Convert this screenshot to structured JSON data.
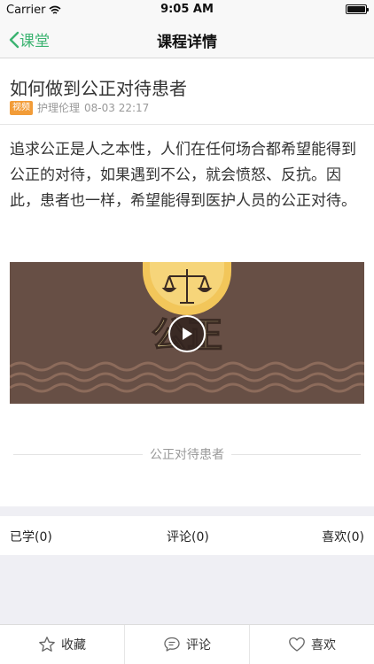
{
  "status_bar": {
    "carrier": "Carrier",
    "time": "9:05 AM"
  },
  "nav": {
    "back_label": "课堂",
    "title": "课程详情"
  },
  "article": {
    "title": "如何做到公正对待患者",
    "tag": "视频",
    "category": "护理伦理",
    "date": "08-03 22:17",
    "body": "追求公正是人之本性，人们在任何场合都希望能得到公正的对待，如果遇到不公，就会愤怒、反抗。因此，患者也一样，希望能得到医护人员的公正对待。"
  },
  "video": {
    "overlay_text": "公正",
    "caption": "公正对待患者"
  },
  "stats": {
    "learned": "已学(0)",
    "comments": "评论(0)",
    "likes": "喜欢(0)"
  },
  "tabs": {
    "favorite": "收藏",
    "comment": "评论",
    "like": "喜欢"
  },
  "colors": {
    "accent": "#3cb371",
    "tag": "#f29c38",
    "video_bg": "#674f45",
    "seal": "#f2c65a"
  }
}
